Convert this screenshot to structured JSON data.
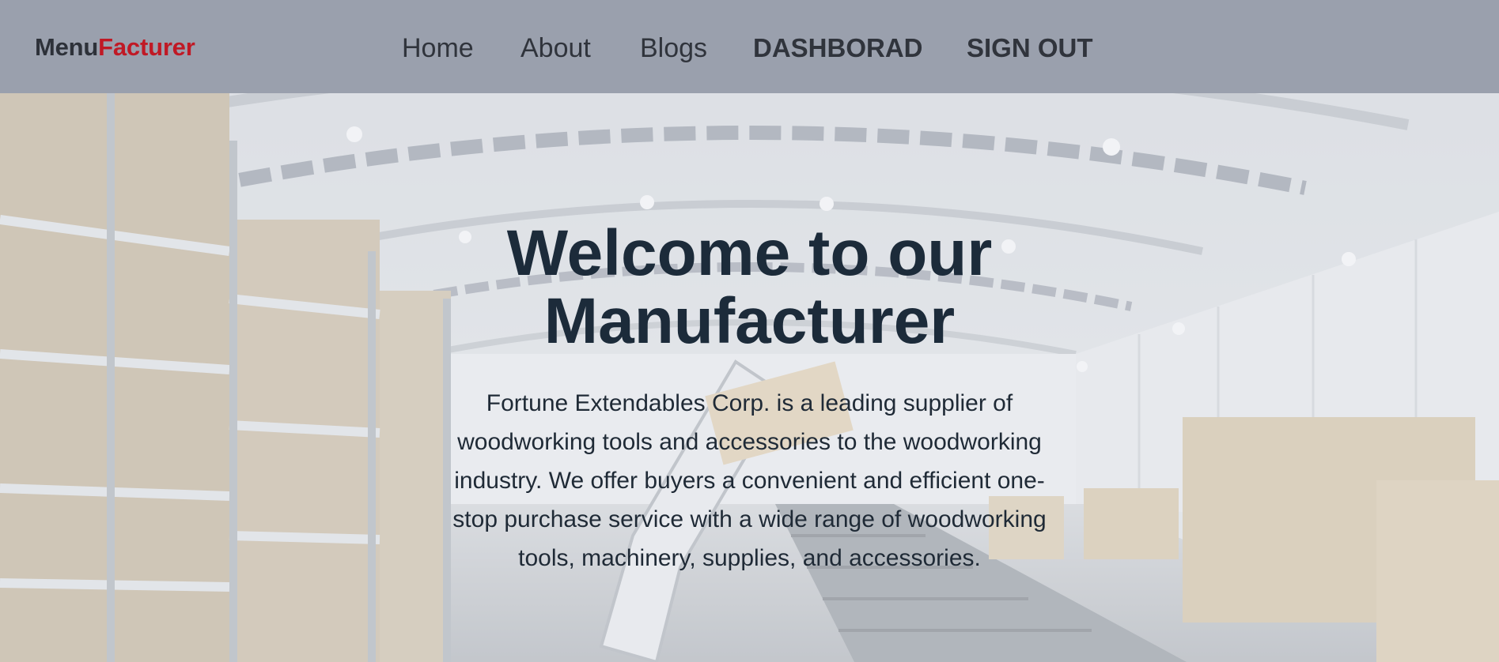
{
  "navbar": {
    "brand_primary": "Menu",
    "brand_accent": "Facturer",
    "links": [
      {
        "label": "Home"
      },
      {
        "label": "About"
      },
      {
        "label": "Blogs"
      },
      {
        "label": "DASHBORAD"
      },
      {
        "label": "SIGN OUT"
      }
    ]
  },
  "hero": {
    "title": "Welcome to our Manufacturer",
    "description": "Fortune Extendables Corp. is a leading supplier of woodworking tools and accessories to the woodworking industry. We offer buyers a convenient and efficient one-stop purchase service with a wide range of woodworking tools, machinery, supplies, and accessories.",
    "background_image": "factory-warehouse-interior"
  },
  "colors": {
    "navbar_bg": "#9aa0ad",
    "brand_accent": "#c01925",
    "title_text": "#1c2b3a"
  }
}
